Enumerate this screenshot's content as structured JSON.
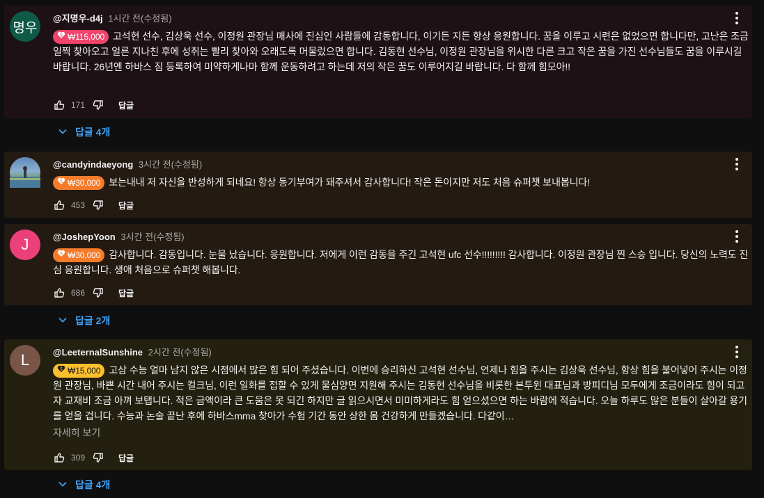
{
  "comments": [
    {
      "avatar_text": "명우",
      "avatar_color": "#0f5a47",
      "author": "@지명우-d4j",
      "time": "1시간 전(수정됨)",
      "badge": {
        "amount": "₩115,000",
        "bg": "#f0446a",
        "fg": "#ffffff"
      },
      "text": "고석현 선수, 김상욱 선수, 이정원 관장님 매사에 진심인 사람들에 감동합니다, 이기든 지든 항상 응원합니다. 꿈을 이루고 시련은 없었으면 합니다만, 고난은 조금 일찍 찾아오고 얼른 지나친 후에 성취는 빨리 찾아와 오래도록 머물렀으면 합니다. 김동현 선수님, 이정원 관장님을 위시한 다른 크고 작은 꿈을 가진 선수님들도 꿈을 이루시길 바랍니다. 26년엔 하바스 짐 등록하여 미약하게나마 함께 운동하려고 하는데 저의 작은 꿈도 이루어지길 바랍니다. 다 함께 힘모아!!",
      "likes": "171",
      "reply_label": "답글",
      "replies_label": "답글 4개"
    },
    {
      "avatar_text": "",
      "avatar_color": "#6a8aa6",
      "author": "@candyindaeyong",
      "time": "3시간 전(수정됨)",
      "badge": {
        "amount": "₩30,000",
        "bg": "#f57b2b",
        "fg": "#ffffff"
      },
      "text": "보는내내 저 자신을 반성하게 되네요! 항상 동기부여가 돼주셔서 감사합니다! 작은 돈이지만 저도 처음 슈퍼챗 보내봅니다!",
      "likes": "453",
      "reply_label": "답글"
    },
    {
      "avatar_text": "J",
      "avatar_color": "#ec407a",
      "author": "@JoshepYoon",
      "time": "3시간 전(수정됨)",
      "badge": {
        "amount": "₩30,000",
        "bg": "#f57b2b",
        "fg": "#ffffff"
      },
      "text": "감사합니다. 감동입니다. 눈물 났습니다. 응원합니다. 저에게 이런 감동을 주긴 고석현 ufc 선수!!!!!!!!! 감사합니다. 이정원 관장님 찐 스승 입니다. 당신의 노력도 진심 응원합니다. 생애 처음으로 슈퍼챗 해봅니다.",
      "likes": "686",
      "reply_label": "답글",
      "replies_label": "답글 2개"
    },
    {
      "avatar_text": "L",
      "avatar_color": "#795548",
      "author": "@LeeternalSunshine",
      "time": "2시간 전(수정됨)",
      "badge": {
        "amount": "₩15,000",
        "bg": "#fbc02d",
        "fg": "#1a1a1a"
      },
      "text": "고삼 수능 얼마 남지 않은 시점에서 많은 힘 되어 주셨습니다. 이번에 승리하신 고석현 선수님, 언제나 힘을 주시는 김상욱 선수님, 항상 힘을 불어넣어 주시는 이정원 관장님, 바쁜 시간 내어 주시는 컬크님, 이런 일화를 접할 수 있게 물심양면 지원해 주시는 김동현 선수님을 비롯한 본투윈 대표님과 방피디님 모두에게 조금이라도 힘이 되고자 교재비 조금 아껴 보탭니다. 적은 금액이라 큰 도움은 못 되긴 하지만 글 읽으시면서 미미하게라도 힘 얻으셨으면 하는 바람에 적습니다. 오늘 하루도 많은 분들이 살아갈 용기를 얻을 겁니다. 수능과 논술 끝난 후에 하바스mma 찾아가 수험 기간 동안 상한 몸 건강하게 만들겠습니다. 다같이…",
      "read_more": "자세히 보기",
      "likes": "309",
      "reply_label": "답글",
      "replies_label": "답글 4개"
    }
  ]
}
